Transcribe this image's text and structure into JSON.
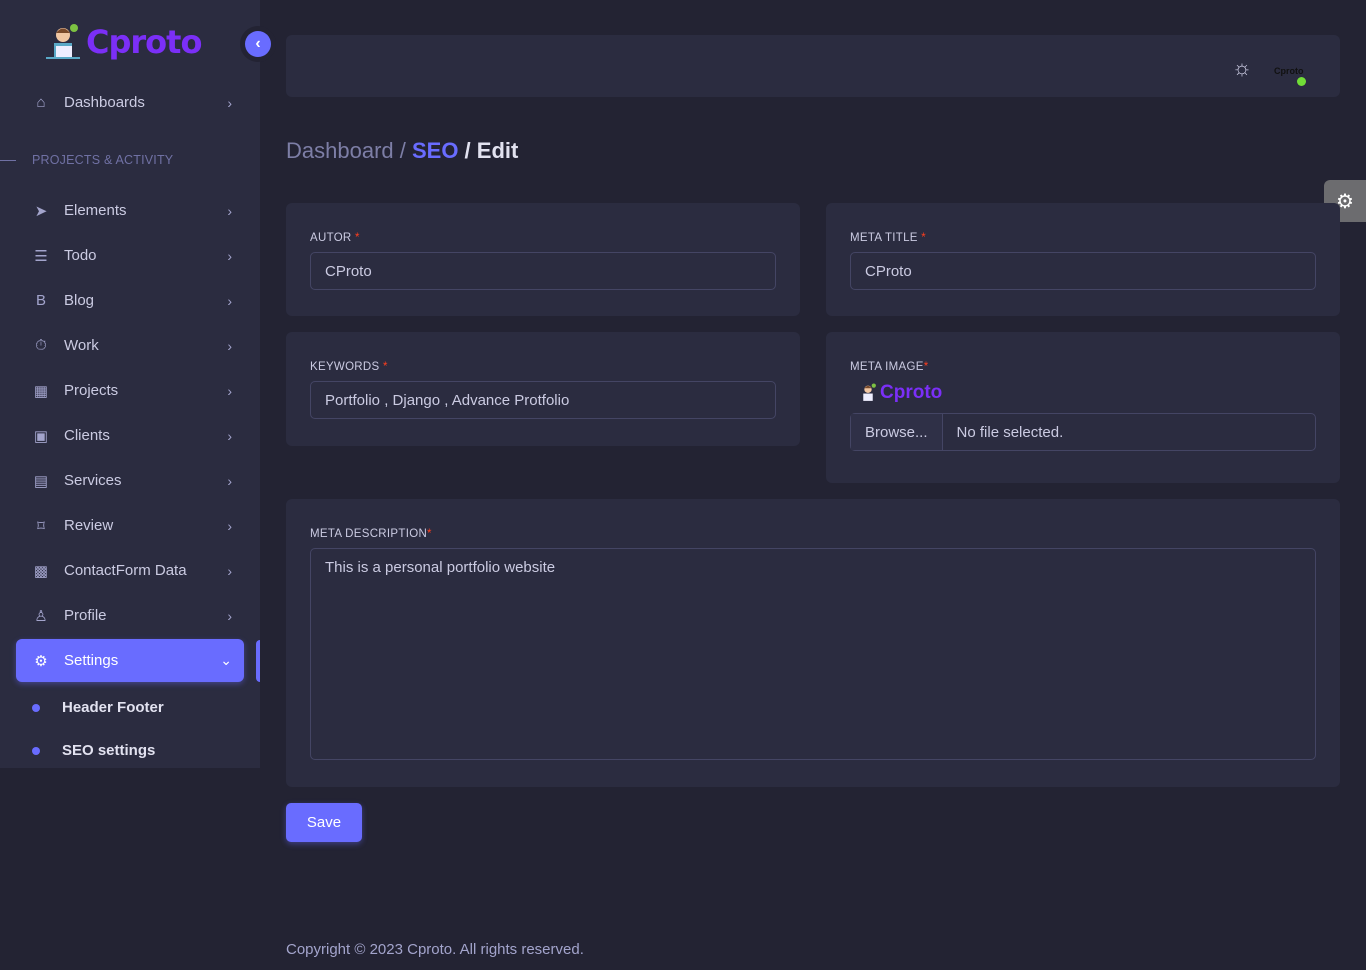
{
  "brand": {
    "name": "Cproto"
  },
  "sidebar": {
    "dashboards": "Dashboards",
    "section": "PROJECTS & ACTIVITY",
    "items": [
      {
        "label": "Elements",
        "icon": "send-icon"
      },
      {
        "label": "Todo",
        "icon": "list-icon"
      },
      {
        "label": "Blog",
        "icon": "blogger-icon"
      },
      {
        "label": "Work",
        "icon": "stopwatch-icon"
      },
      {
        "label": "Projects",
        "icon": "calendar-icon"
      },
      {
        "label": "Clients",
        "icon": "user-badge-icon"
      },
      {
        "label": "Services",
        "icon": "briefcase-icon"
      },
      {
        "label": "Review",
        "icon": "bookmark-icon"
      },
      {
        "label": "ContactForm Data",
        "icon": "contact-book-icon"
      },
      {
        "label": "Profile",
        "icon": "user-icon"
      },
      {
        "label": "Settings",
        "icon": "gear-icon"
      }
    ],
    "sub": [
      "Header Footer",
      "SEO settings"
    ]
  },
  "header": {
    "user_name": "Cproto"
  },
  "breadcrumb": {
    "home": "Dashboard / ",
    "seo": "SEO",
    "edit": " / Edit"
  },
  "form": {
    "autor_label": "AUTOR",
    "autor_value": "CProto",
    "meta_title_label": "META TITLE",
    "meta_title_value": "CProto",
    "keywords_label": "KEYWORDS",
    "keywords_value": "Portfolio , Django  , Advance Protfolio",
    "meta_image_label": "META IMAGE",
    "browse": "Browse...",
    "no_file": "No file selected.",
    "meta_desc_label": "META DESCRIPTION",
    "meta_desc_value": "This is a personal portfolio website",
    "required": "*",
    "save": "Save"
  },
  "footer": "Copyright © 2023 Cproto. All rights reserved."
}
